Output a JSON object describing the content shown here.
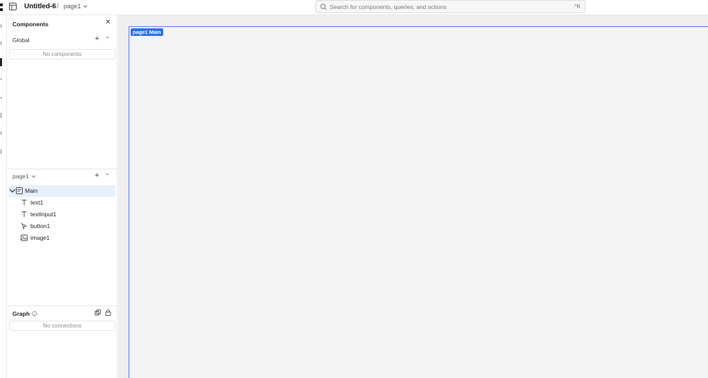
{
  "app": {
    "title": "Untitled-6",
    "separator": "/",
    "current_page": "page1"
  },
  "search": {
    "placeholder": "Search for components, queries, and actions",
    "shortcut": "^K"
  },
  "sidebar": {
    "header": "Components",
    "global": {
      "title": "Global",
      "empty_text": "No components"
    },
    "page": {
      "selected": "page1",
      "tree": [
        {
          "label": "Main",
          "icon": "frame-icon"
        },
        {
          "label": "text1",
          "icon": "text-type-icon"
        },
        {
          "label": "textInput1",
          "icon": "text-type-icon"
        },
        {
          "label": "button1",
          "icon": "pointer-click-icon"
        },
        {
          "label": "image1",
          "icon": "image-icon"
        }
      ]
    },
    "graph": {
      "title": "Graph",
      "empty_text": "No connections"
    }
  },
  "canvas": {
    "frame_tag": "page1 Main"
  },
  "colors": {
    "accent": "#2f6fe4",
    "selection": "#e7f0fd",
    "canvas_bg": "#f4f4f4"
  }
}
